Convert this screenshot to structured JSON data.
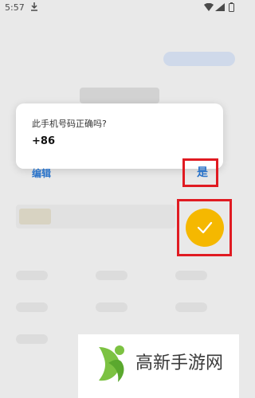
{
  "status_bar": {
    "time": "5:57"
  },
  "dialog": {
    "question": "此手机号码正确吗?",
    "phone": "+86",
    "edit_label": "编辑",
    "confirm_label": "是"
  },
  "fab": {
    "icon": "check-icon"
  },
  "watermark": {
    "text": "高新手游网"
  },
  "colors": {
    "accent": "#2a73c9",
    "fab": "#f5b800",
    "highlight": "#e01b22"
  }
}
